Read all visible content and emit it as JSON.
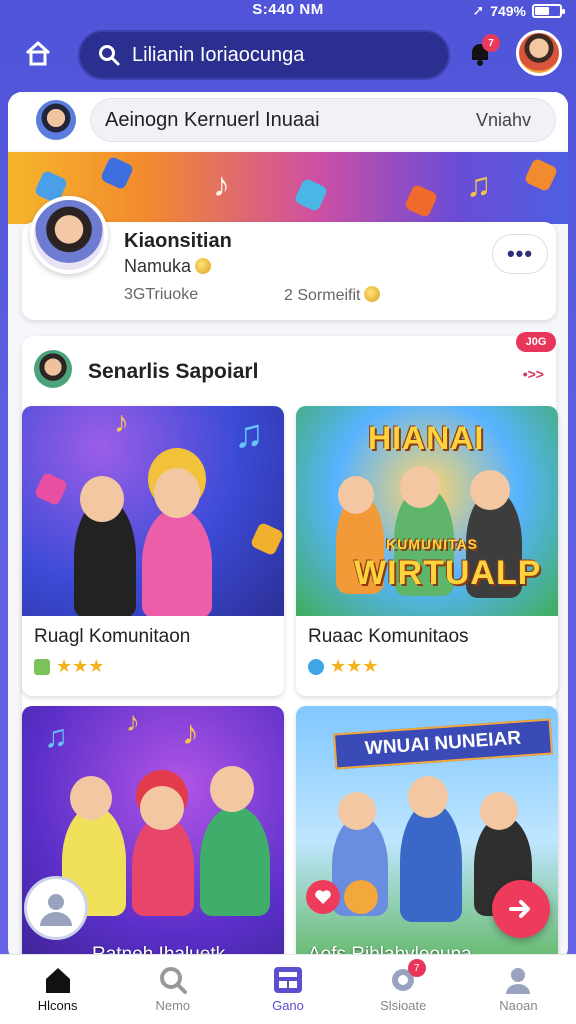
{
  "status_bar": {
    "time": "S:440 NM",
    "battery": "749%"
  },
  "top_bar": {
    "search_text": "Lilianin Ioriaocunga",
    "notification_count": "7"
  },
  "composer": {
    "placeholder": "Aeinogn Kernuerl Inuaai",
    "action_label": "Vniahv"
  },
  "profile": {
    "name": "Kiaonsitian",
    "subtitle": "Namuka",
    "stat_left": "3GTriuoke",
    "stat_right": "2 Sormeifit",
    "more_label": "•••"
  },
  "section": {
    "title": "Senarlis Sapoiarl",
    "badge": "J0G",
    "arrow": "•>>"
  },
  "tiles": [
    {
      "title": "Ruagl Komunitaon",
      "rating": "★★★"
    },
    {
      "title": "Ruaac Komunitaos",
      "rating": "★★★",
      "poster_top": "HIANAI",
      "poster_mid": "KUMUNITAS",
      "poster_bottom": "WIRTUALP"
    },
    {
      "title": "",
      "caption": "Ratneh Ihaluetk"
    },
    {
      "title": "",
      "caption": "Aofs Rihlahvleouna",
      "banner": "WNUAI NUNEIAR"
    }
  ],
  "bottom_nav": [
    {
      "label": "Hlcons",
      "icon": "home-icon"
    },
    {
      "label": "Nemo",
      "icon": "search-icon"
    },
    {
      "label": "Gano",
      "icon": "games-icon"
    },
    {
      "label": "Slsioate",
      "icon": "chat-icon",
      "badge": "7"
    },
    {
      "label": "Naoan",
      "icon": "profile-icon"
    }
  ],
  "colors": {
    "accent": "#5a5fe0",
    "primary_dark": "#2b2f8f",
    "alert": "#ef3b5b",
    "star": "#f3b31b"
  }
}
